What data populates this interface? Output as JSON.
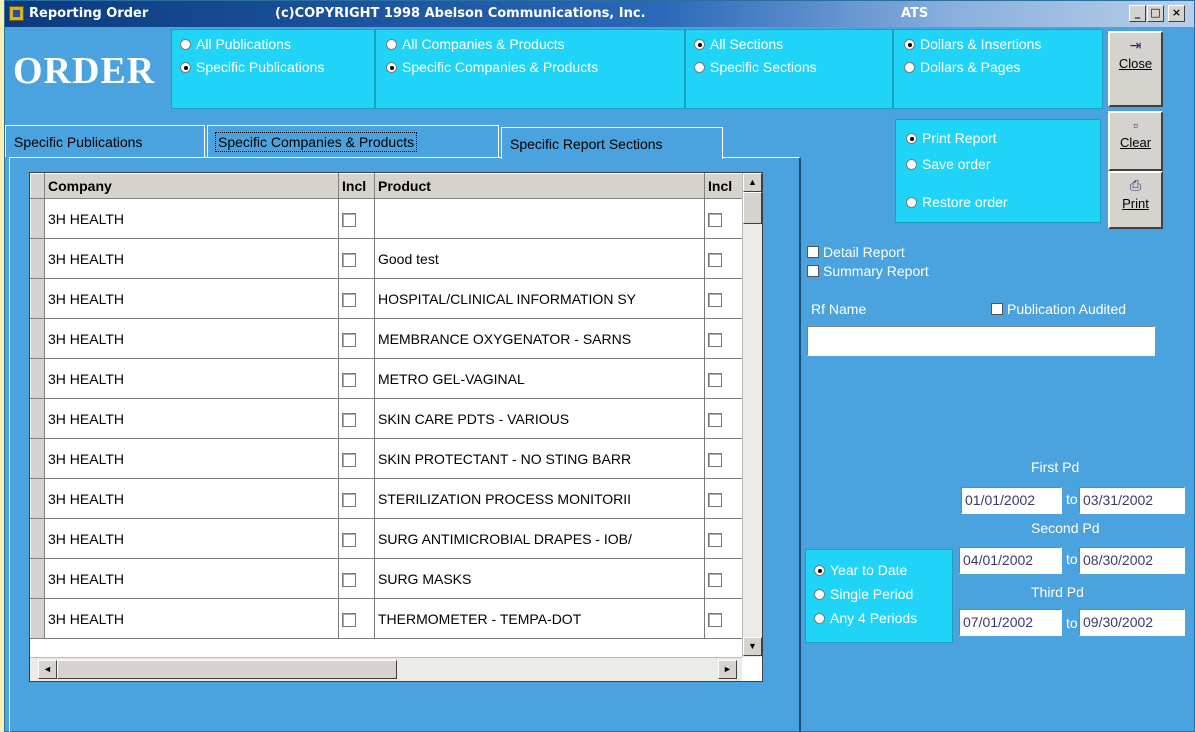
{
  "window": {
    "app_title": "Reporting Order",
    "copyright": "(c)COPYRIGHT 1998 Abelson Communications, Inc.",
    "user": "ATS",
    "minimize_glyph": "_",
    "maximize_glyph": "□",
    "close_glyph": "×",
    "app_icon": "app-grid-icon"
  },
  "logo": "ORDER",
  "publications": {
    "all": "All Publications",
    "specific": "Specific Publications",
    "selected": "specific"
  },
  "companies": {
    "all": "All Companies & Products",
    "specific": "Specific Companies & Products",
    "selected": "specific"
  },
  "sections": {
    "all": "All Sections",
    "specific": "Specific Sections",
    "selected": "all"
  },
  "measure": {
    "insertions": "Dollars & Insertions",
    "pages": "Dollars & Pages",
    "selected": "insertions"
  },
  "action": {
    "print": "Print Report",
    "save": "Save order",
    "restore": "Restore order",
    "selected": "print"
  },
  "side_buttons": [
    {
      "label": "Close",
      "icon": "exit-door-icon"
    },
    {
      "label": "Clear",
      "icon": "eraser-icon"
    },
    {
      "label": "Print",
      "icon": "printer-icon"
    }
  ],
  "tabs": [
    "Specific Publications",
    "Specific Companies & Products",
    "Specific Report Sections"
  ],
  "active_tab": 1,
  "grid": {
    "columns": [
      "Company",
      "Incl",
      "Product",
      "Incl"
    ],
    "rows": [
      {
        "company": "3H HEALTH",
        "product": ""
      },
      {
        "company": "3H HEALTH",
        "product": "Good test"
      },
      {
        "company": "3H HEALTH",
        "product": "HOSPITAL/CLINICAL INFORMATION SY"
      },
      {
        "company": "3H HEALTH",
        "product": "MEMBRANCE OXYGENATOR - SARNS"
      },
      {
        "company": "3H HEALTH",
        "product": "METRO GEL-VAGINAL"
      },
      {
        "company": "3H HEALTH",
        "product": "SKIN CARE PDTS - VARIOUS"
      },
      {
        "company": "3H HEALTH",
        "product": "SKIN PROTECTANT - NO STING BARR"
      },
      {
        "company": "3H HEALTH",
        "product": "STERILIZATION PROCESS MONITORII"
      },
      {
        "company": "3H HEALTH",
        "product": "SURG ANTIMICROBIAL DRAPES - IOB/"
      },
      {
        "company": "3H HEALTH",
        "product": "SURG MASKS"
      },
      {
        "company": "3H HEALTH",
        "product": "THERMOMETER - TEMPA-DOT"
      }
    ],
    "scroll_up": "▲",
    "scroll_down": "▼",
    "scroll_left": "◄",
    "scroll_right": "►"
  },
  "report_options": {
    "detail": "Detail Report",
    "summary": "Summary Report",
    "rf_name_label": "Rf Name",
    "rf_name_value": "",
    "pub_audited": "Publication Audited"
  },
  "periods": {
    "first_label": "First    Pd",
    "second_label": "Second Pd",
    "third_label": "Third    Pd",
    "to": "to",
    "first_from": "01/01/2002",
    "first_to": "03/31/2002",
    "second_from": "04/01/2002",
    "second_to": "08/30/2002",
    "third_from": "07/01/2002",
    "third_to": "09/30/2002",
    "mode": {
      "ytd": "Year to Date",
      "single": "Single Period",
      "any4": "Any 4 Periods",
      "selected": "ytd"
    }
  }
}
